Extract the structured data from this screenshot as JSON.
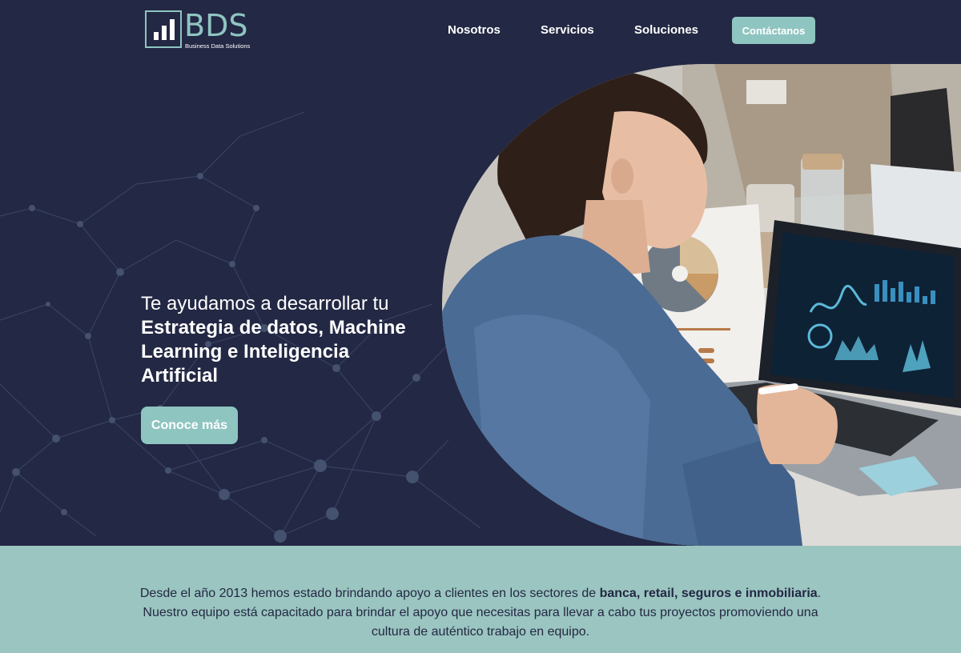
{
  "brand": {
    "logo_letters": "BDS",
    "logo_tagline": "Business Data Solutions",
    "colors": {
      "navy": "#232844",
      "teal": "#8fc5c1",
      "band": "#9bc5c0"
    }
  },
  "nav": {
    "items": [
      {
        "label": "Nosotros"
      },
      {
        "label": "Servicios"
      },
      {
        "label": "Soluciones"
      }
    ],
    "cta_label": "Contáctanos"
  },
  "hero": {
    "line1": "Te ayudamos a desarrollar tu",
    "strong1": "Estrategia de datos, Machine",
    "strong2": "Learning e Inteligencia",
    "strong3": "Artificial",
    "button_label": "Conoce más",
    "image_alt": "woman-working-on-laptop-with-dashboards"
  },
  "intro": {
    "part1": "Desde el año 2013 hemos estado brindando apoyo a clientes en los sectores de ",
    "bold1": "banca, retail, seguros e inmobiliaria",
    "part2": ". Nuestro equipo está capacitado para brindar el apoyo que necesitas para llevar a cabo tus proyectos promoviendo una cultura de auténtico trabajo en equipo."
  }
}
